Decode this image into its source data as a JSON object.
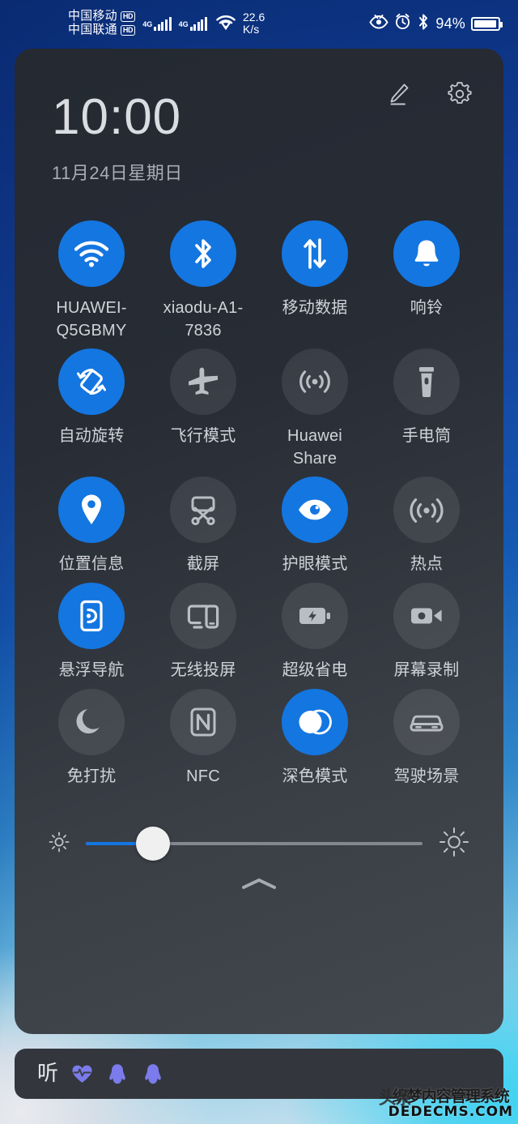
{
  "statusbar": {
    "carrier1": "中国移动",
    "carrier1_badge": "HD",
    "carrier2": "中国联通",
    "carrier2_badge": "HD",
    "net_type_1": "4G",
    "net_type_2": "4G",
    "net_speed_value": "22.6",
    "net_speed_unit": "K/s",
    "wifi_icon": "wifi-icon",
    "eye_comfort_icon": "eye-comfort-icon",
    "alarm_icon": "alarm-clock-icon",
    "bluetooth_icon": "bluetooth-icon",
    "battery_percent": "94%",
    "battery_icon": "battery-icon"
  },
  "header": {
    "time": "10:00",
    "date": "11月24日星期日",
    "edit_icon": "pencil-edit-icon",
    "settings_icon": "gear-settings-icon"
  },
  "toggles": [
    {
      "label": "HUAWEI-Q5GBMY",
      "icon": "wifi-icon",
      "active": true
    },
    {
      "label": "xiaodu-A1-7836",
      "icon": "bluetooth-icon",
      "active": true
    },
    {
      "label": "移动数据",
      "icon": "mobile-data-icon",
      "active": true
    },
    {
      "label": "响铃",
      "icon": "bell-ring-icon",
      "active": true
    },
    {
      "label": "自动旋转",
      "icon": "auto-rotate-icon",
      "active": true
    },
    {
      "label": "飞行模式",
      "icon": "airplane-icon",
      "active": false
    },
    {
      "label": "Huawei Share",
      "icon": "huawei-share-icon",
      "active": false
    },
    {
      "label": "手电筒",
      "icon": "flashlight-icon",
      "active": false
    },
    {
      "label": "位置信息",
      "icon": "location-pin-icon",
      "active": true
    },
    {
      "label": "截屏",
      "icon": "screenshot-icon",
      "active": false
    },
    {
      "label": "护眼模式",
      "icon": "eye-comfort-icon",
      "active": true
    },
    {
      "label": "热点",
      "icon": "hotspot-icon",
      "active": false
    },
    {
      "label": "悬浮导航",
      "icon": "floating-nav-icon",
      "active": true
    },
    {
      "label": "无线投屏",
      "icon": "cast-screen-icon",
      "active": false
    },
    {
      "label": "超级省电",
      "icon": "battery-saver-icon",
      "active": false
    },
    {
      "label": "屏幕录制",
      "icon": "screen-record-icon",
      "active": false
    },
    {
      "label": "免打扰",
      "icon": "do-not-disturb-icon",
      "active": false
    },
    {
      "label": "NFC",
      "icon": "nfc-icon",
      "active": false
    },
    {
      "label": "深色模式",
      "icon": "dark-mode-icon",
      "active": true
    },
    {
      "label": "驾驶场景",
      "icon": "car-driving-icon",
      "active": false
    }
  ],
  "brightness": {
    "low_icon": "brightness-low-icon",
    "high_icon": "brightness-high-icon",
    "value_percent": "20",
    "collapse_icon": "chevron-up-icon"
  },
  "notifications": {
    "app_text": "听",
    "icons": [
      "heartbeat-icon",
      "qq-penguin-icon",
      "qq-penguin-icon"
    ]
  },
  "watermark": {
    "head_text": "头条",
    "top_text": "织梦内容管理系统",
    "bottom_text": "DEDECMS.COM"
  },
  "colors": {
    "accent_blue": "#1476e0",
    "panel_dark": "#272c35",
    "inactive_circle": "rgba(255,255,255,0.085)",
    "notif_icon_purple": "#7b7bec"
  }
}
